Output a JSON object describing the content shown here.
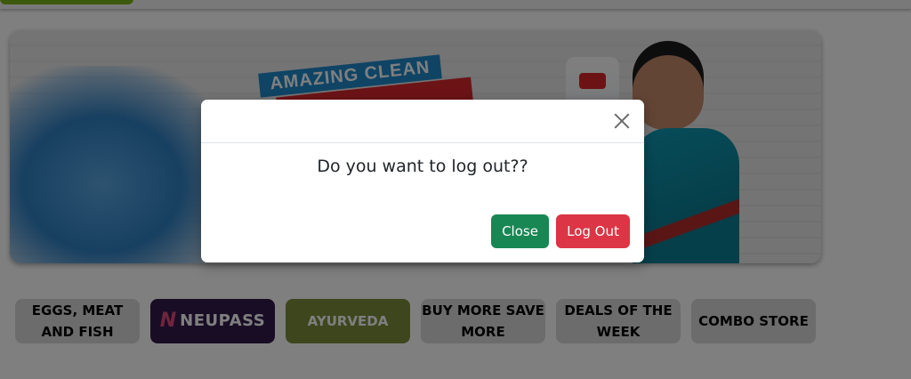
{
  "banner": {
    "tagline": "AMAZING CLEAN"
  },
  "categories": [
    {
      "label": "EGGS, MEAT AND FISH"
    },
    {
      "label": "NEUPASS"
    },
    {
      "label": "AYURVEDA"
    },
    {
      "label": "BUY MORE SAVE MORE"
    },
    {
      "label": "DEALS OF THE WEEK"
    },
    {
      "label": "COMBO STORE"
    }
  ],
  "modal": {
    "message": "Do you want to log out??",
    "close_label": "Close",
    "logout_label": "Log Out"
  },
  "colors": {
    "close_button": "#198754",
    "logout_button": "#dc3545",
    "neupass_bg": "#331a4a",
    "ayurveda_bg": "#7d8c3a"
  }
}
